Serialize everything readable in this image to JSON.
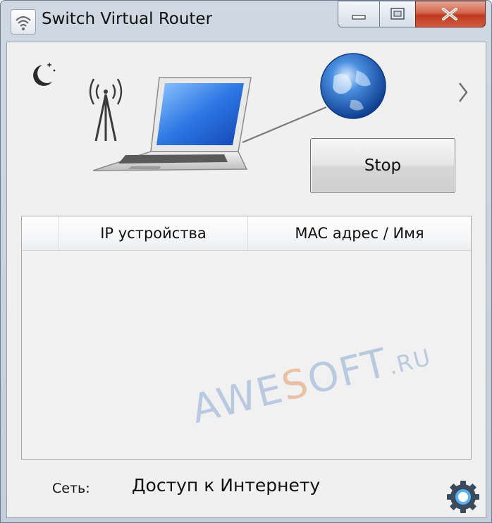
{
  "window": {
    "title": "Switch Virtual Router",
    "controls": {
      "minimize_icon": "minimize-icon",
      "maximize_icon": "maximize-icon",
      "close_icon": "close-icon"
    }
  },
  "toolbar": {
    "stop_label": "Stop",
    "theme_icon": "moon-icon",
    "next_icon": "chevron-right-icon"
  },
  "table": {
    "columns": [
      "",
      "IP устройства",
      "MAC адрес / Имя"
    ],
    "rows": []
  },
  "status": {
    "network_label": "Сеть:",
    "network_value": "Доступ к Интернету"
  },
  "watermark": {
    "part1": "AWE",
    "part2": "S",
    "part3": "OFT",
    "part4": ".RU"
  },
  "colors": {
    "close_button": "#c8462c",
    "accent": "#2d6fc4"
  }
}
